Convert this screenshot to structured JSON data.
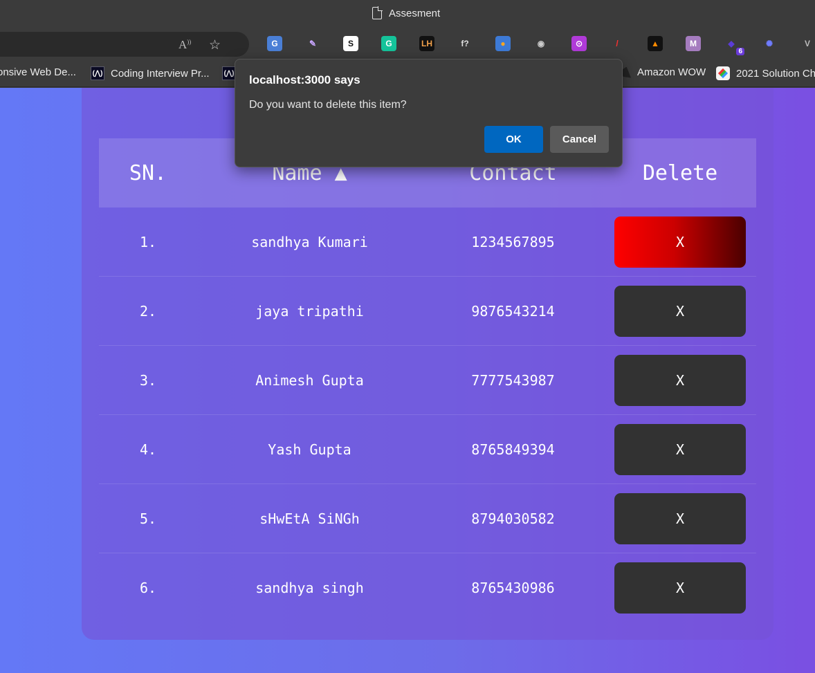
{
  "window": {
    "title": "Assesment"
  },
  "extensions": [
    {
      "name": "translate-icon",
      "glyph": "G",
      "bg": "#4a7fd6",
      "fg": "#ffffff"
    },
    {
      "name": "color-picker-icon",
      "glyph": "✎",
      "bg": "transparent",
      "fg": "#c9a6ff"
    },
    {
      "name": "s-icon",
      "glyph": "S",
      "bg": "#ffffff",
      "fg": "#111111"
    },
    {
      "name": "grammarly-icon",
      "glyph": "G",
      "bg": "#15c39a",
      "fg": "#ffffff"
    },
    {
      "name": "lh-icon",
      "glyph": "LH",
      "bg": "#111111",
      "fg": "#f2a14a"
    },
    {
      "name": "function-icon",
      "glyph": "f?",
      "bg": "transparent",
      "fg": "#e0e0e0"
    },
    {
      "name": "react-devtools-icon",
      "glyph": "●",
      "bg": "#3d7ad6",
      "fg": "#f5a623"
    },
    {
      "name": "camera-icon",
      "glyph": "◉",
      "bg": "transparent",
      "fg": "#cccccc"
    },
    {
      "name": "api-icon",
      "glyph": "⊙",
      "bg": "#b03ad8",
      "fg": "#ffffff"
    },
    {
      "name": "marker-icon",
      "glyph": "/",
      "bg": "transparent",
      "fg": "#ff3030"
    },
    {
      "name": "fire-icon",
      "glyph": "▲",
      "bg": "#111111",
      "fg": "#ff8a00"
    },
    {
      "name": "m-icon",
      "glyph": "M",
      "bg": "#a57cbf",
      "fg": "#ffffff"
    },
    {
      "name": "cube-icon",
      "glyph": "◆",
      "bg": "transparent",
      "fg": "#5b3cd6",
      "badge": "6"
    },
    {
      "name": "sparkle-icon",
      "glyph": "✺",
      "bg": "transparent",
      "fg": "#6f7cff"
    },
    {
      "name": "vue-icon",
      "glyph": "V",
      "bg": "transparent",
      "fg": "#bbbbbb"
    }
  ],
  "bookmarks": [
    {
      "label": "onsive Web De...",
      "icon": "none"
    },
    {
      "label": "Coding Interview Pr...",
      "icon": "fcc"
    },
    {
      "label": "",
      "icon": "fcc"
    },
    {
      "label": "Amazon WOW",
      "icon": "amazon"
    },
    {
      "label": "2021 Solution Ch",
      "icon": "solution"
    }
  ],
  "table": {
    "headers": [
      "SN.",
      "Name ▲",
      "Contact",
      "Delete"
    ],
    "rows": [
      {
        "sn": "1.",
        "name": "sandhya Kumari",
        "contact": "1234567895",
        "action": "X",
        "hover": true
      },
      {
        "sn": "2.",
        "name": "jaya tripathi",
        "contact": "9876543214",
        "action": "X",
        "hover": false
      },
      {
        "sn": "3.",
        "name": "Animesh Gupta",
        "contact": "7777543987",
        "action": "X",
        "hover": false
      },
      {
        "sn": "4.",
        "name": "Yash Gupta",
        "contact": "8765849394",
        "action": "X",
        "hover": false
      },
      {
        "sn": "5.",
        "name": "sHwEtA SiNGh",
        "contact": "8794030582",
        "action": "X",
        "hover": false
      },
      {
        "sn": "6.",
        "name": "sandhya singh",
        "contact": "8765430986",
        "action": "X",
        "hover": false
      }
    ]
  },
  "dialog": {
    "title": "localhost:3000 says",
    "message": "Do you want to delete this item?",
    "ok_label": "OK",
    "cancel_label": "Cancel"
  }
}
